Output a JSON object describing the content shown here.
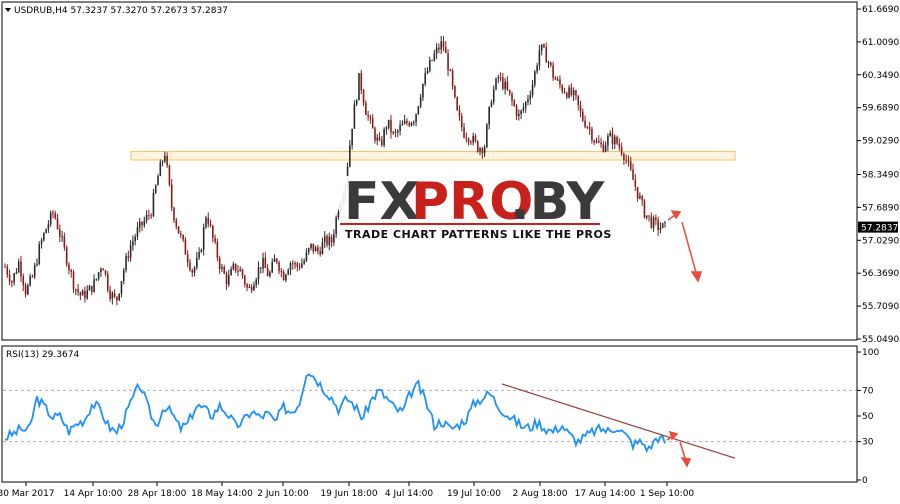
{
  "chart_data": [
    {
      "type": "candlestick",
      "symbol_header": "USDRUB,H4  57.3237 57.3270 57.2673 57.2837",
      "y_ticks": [
        "61.6690",
        "61.0090",
        "60.3490",
        "59.6890",
        "59.0290",
        "58.3490",
        "57.6890",
        "57.0290",
        "56.3690",
        "55.7090",
        "55.0490"
      ],
      "ylim": [
        55.049,
        61.669
      ],
      "current_price_label": "57.2837",
      "x_ticks": [
        "30 Mar 2017",
        "14 Apr 10:00",
        "28 Apr 18:00",
        "18 May 14:00",
        "2 Jun 10:00",
        "19 Jun 18:00",
        "4 Jul 14:00",
        "19 Jul 10:00",
        "2 Aug 18:00",
        "17 Aug 14:00",
        "1 Sep 10:00"
      ],
      "close_path": [
        56.5,
        56.2,
        56.6,
        56.0,
        56.3,
        56.9,
        57.3,
        57.6,
        57.1,
        56.6,
        56.1,
        55.9,
        56.0,
        56.2,
        56.6,
        56.0,
        55.8,
        56.4,
        56.9,
        57.2,
        57.4,
        57.6,
        58.3,
        58.8,
        57.7,
        57.2,
        56.8,
        56.4,
        56.7,
        57.6,
        57.0,
        56.5,
        56.2,
        56.5,
        56.4,
        56.0,
        56.3,
        56.6,
        56.3,
        56.7,
        56.3,
        56.6,
        56.5,
        56.6,
        56.9,
        56.8,
        57.0,
        57.0,
        57.7,
        58.2,
        59.4,
        60.3,
        59.6,
        59.2,
        58.9,
        59.4,
        59.1,
        59.3,
        59.4,
        59.5,
        60.1,
        60.5,
        60.8,
        61.0,
        60.4,
        59.6,
        59.2,
        59.1,
        58.9,
        58.9,
        59.9,
        60.3,
        60.1,
        59.8,
        59.5,
        59.8,
        60.2,
        60.9,
        60.7,
        60.3,
        60.1,
        60.0,
        59.9,
        59.5,
        59.3,
        59.0,
        58.9,
        59.1,
        59.0,
        58.8,
        58.4,
        58.0,
        57.6,
        57.4,
        57.3,
        57.28
      ],
      "support_zone": [
        58.64,
        58.81
      ],
      "forecast_arrows": "red arrows pointing down",
      "grid": false
    },
    {
      "type": "line",
      "indicator_header": "RSI(13) 29.3674",
      "y_ticks": [
        "100",
        "70",
        "50",
        "30",
        "0"
      ],
      "ylim": [
        0,
        100
      ],
      "series": [
        {
          "values": [
            33,
            36,
            40,
            38,
            64,
            57,
            49,
            50,
            38,
            44,
            47,
            60,
            55,
            42,
            37,
            48,
            63,
            75,
            56,
            42,
            58,
            52,
            40,
            44,
            58,
            56,
            50,
            58,
            52,
            42,
            46,
            54,
            49,
            52,
            45,
            57,
            53,
            60,
            87,
            80,
            72,
            65,
            55,
            64,
            58,
            48,
            62,
            70,
            64,
            56,
            53,
            68,
            74,
            60,
            43,
            46,
            40,
            43,
            48,
            60,
            64,
            68,
            58,
            52,
            47,
            42,
            41,
            45,
            40,
            38,
            43,
            35,
            30,
            34,
            38,
            40,
            38,
            42,
            35,
            28,
            30,
            24,
            34,
            30
          ]
        }
      ],
      "trendline": [
        75,
        17
      ],
      "forecast_arrows": "red arrows pointing down",
      "grid": false
    }
  ],
  "watermark": {
    "fx": "FX",
    "pro": "PRO",
    "by": ".BY",
    "tagline": "TRADE CHART PATTERNS LIKE THE PROS"
  }
}
